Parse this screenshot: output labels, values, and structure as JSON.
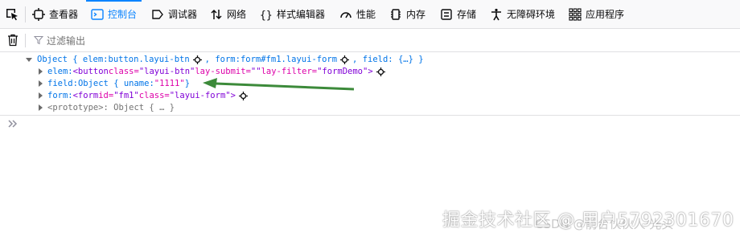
{
  "toolbar": {
    "tabs": [
      {
        "label": "查看器",
        "icon": "inspector-icon"
      },
      {
        "label": "控制台",
        "icon": "console-icon",
        "selected": true
      },
      {
        "label": "调试器",
        "icon": "debugger-icon"
      },
      {
        "label": "网络",
        "icon": "network-icon"
      },
      {
        "label": "样式编辑器",
        "icon": "style-editor-icon"
      },
      {
        "label": "性能",
        "icon": "performance-icon"
      },
      {
        "label": "内存",
        "icon": "memory-icon"
      },
      {
        "label": "存储",
        "icon": "storage-icon"
      },
      {
        "label": "无障碍环境",
        "icon": "accessibility-icon"
      },
      {
        "label": "应用程序",
        "icon": "application-icon"
      }
    ]
  },
  "filter": {
    "placeholder": "过滤输出"
  },
  "console": {
    "obj_prefix": "Object { elem: ",
    "obj_elem": "button.layui-btn",
    "obj_form_key": ", form: ",
    "obj_form": "form#fm1.layui-form",
    "obj_field": ", field: {…} }",
    "elem_key": "elem: ",
    "elem_tag_open": "<button ",
    "elem_attr1": "class=",
    "elem_val1": "\"layui-btn\"",
    "elem_attr2": " lay-submit=",
    "elem_val2": "\"\"",
    "elem_attr3": " lay-filter=",
    "elem_val3": "\"formDemo\"",
    "elem_tag_close": ">",
    "field_key": "field: ",
    "field_obj": "Object { uname: ",
    "field_val": "\"1111\"",
    "field_end": " }",
    "form_key": "form: ",
    "form_tag_open": "<form ",
    "form_attr1": "id=",
    "form_val1": "\"fm1\"",
    "form_attr2": " class=",
    "form_val2": "\"layui-form\"",
    "form_tag_close": ">",
    "proto": "<prototype>: Object { … }"
  },
  "watermark": {
    "primary": "掘金技术社区 @ 用户5792301670",
    "secondary": "CSDN @前台伙伙人·光头"
  },
  "colors": {
    "accent": "#0a84ff",
    "arrow": "#3c8a3a"
  }
}
